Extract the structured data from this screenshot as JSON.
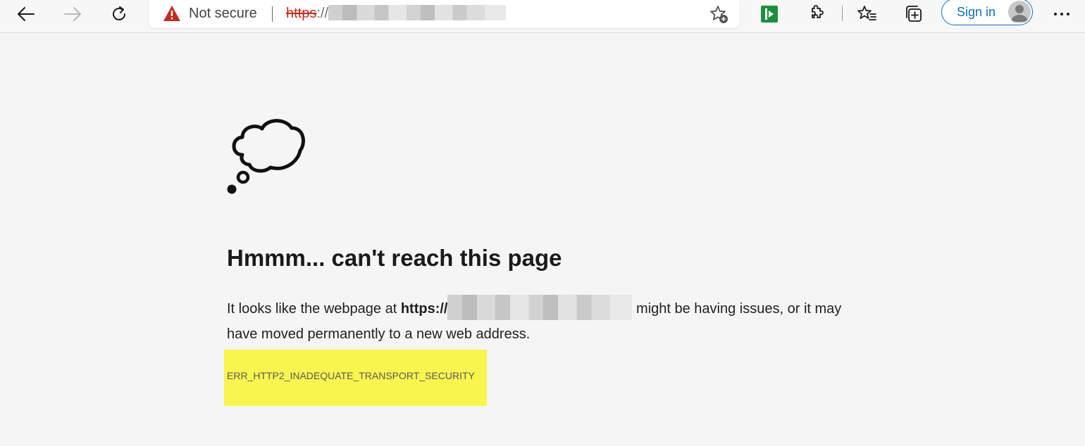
{
  "browser": {
    "security_label": "Not secure",
    "url_scheme": "https",
    "url_rest": "://",
    "signin_label": "Sign in",
    "accent_color": "#0f6cbd",
    "warning_color": "#c42b1c",
    "icons": [
      "back-arrow-icon",
      "forward-arrow-icon",
      "refresh-icon",
      "warning-triangle-icon",
      "add-favorite-icon",
      "reader-extension-icon",
      "extensions-puzzle-icon",
      "favorites-icon",
      "collections-icon",
      "avatar-icon",
      "more-menu-icon"
    ]
  },
  "error_page": {
    "title": "Hmmm... can't reach this page",
    "desc_before": "It looks like the webpage at ",
    "desc_url": "https://",
    "desc_after": " might be having issues, or it may have moved permanently to a new web address.",
    "error_code": "ERR_HTTP2_INADEQUATE_TRANSPORT_SECURITY",
    "highlight_color": "#f7f54e"
  }
}
